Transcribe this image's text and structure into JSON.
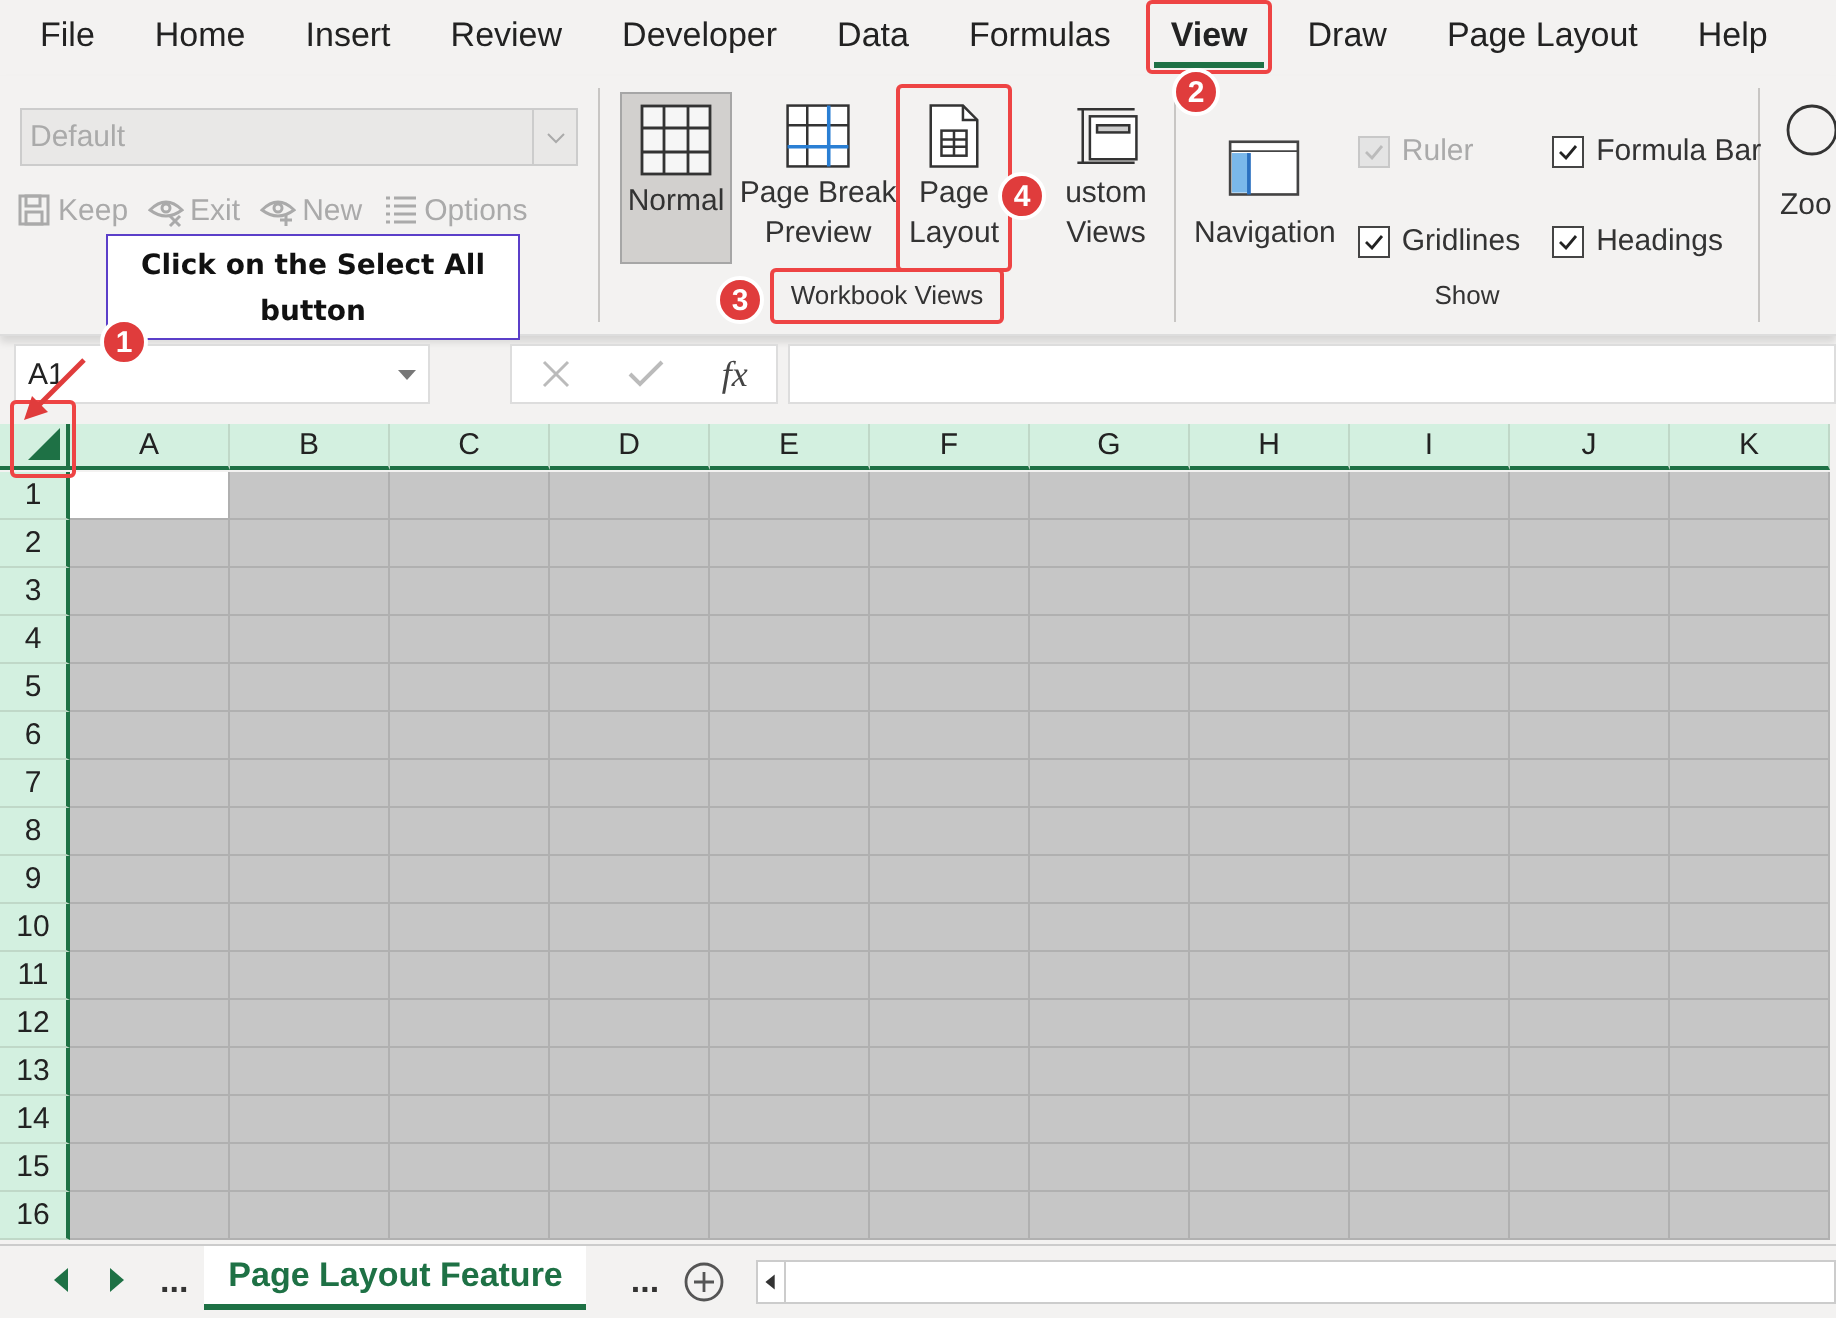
{
  "menu_tabs": [
    {
      "label": "File",
      "selected": false
    },
    {
      "label": "Home",
      "selected": false
    },
    {
      "label": "Insert",
      "selected": false
    },
    {
      "label": "Review",
      "selected": false
    },
    {
      "label": "Developer",
      "selected": false
    },
    {
      "label": "Data",
      "selected": false
    },
    {
      "label": "Formulas",
      "selected": false
    },
    {
      "label": "View",
      "selected": true
    },
    {
      "label": "Draw",
      "selected": false
    },
    {
      "label": "Page Layout",
      "selected": false
    },
    {
      "label": "Help",
      "selected": false
    }
  ],
  "sheet_view": {
    "dropdown": {
      "value": "Default",
      "disabled": true
    },
    "buttons": [
      {
        "label": "Keep",
        "disabled": true
      },
      {
        "label": "Exit",
        "disabled": true
      },
      {
        "label": "New",
        "disabled": true
      },
      {
        "label": "Options",
        "disabled": true
      }
    ]
  },
  "workbook_views": {
    "label": "Workbook Views",
    "buttons": [
      {
        "lines": [
          "Normal"
        ],
        "selected": true
      },
      {
        "lines": [
          "Page Break",
          "Preview"
        ],
        "selected": false
      },
      {
        "lines": [
          "Page",
          "Layout"
        ],
        "selected": false
      },
      {
        "lines": [
          "ustom",
          "Views"
        ],
        "selected": false
      }
    ]
  },
  "show": {
    "label": "Show",
    "navigation": "Navigation",
    "checkboxes": [
      {
        "label": "Ruler",
        "checked": true,
        "disabled": true
      },
      {
        "label": "Gridlines",
        "checked": true,
        "disabled": false
      },
      {
        "label": "Formula Bar",
        "checked": true,
        "disabled": false
      },
      {
        "label": "Headings",
        "checked": true,
        "disabled": false
      }
    ]
  },
  "zoom_group": {
    "label": "Zoo"
  },
  "formula_bar": {
    "name_box": "A1",
    "function_symbol": "fx"
  },
  "grid": {
    "columns": [
      "A",
      "B",
      "C",
      "D",
      "E",
      "F",
      "G",
      "H",
      "I",
      "J",
      "K"
    ],
    "rows": [
      "1",
      "2",
      "3",
      "4",
      "5",
      "6",
      "7",
      "8",
      "9",
      "10",
      "11",
      "12",
      "13",
      "14",
      "15",
      "16"
    ]
  },
  "sheet_tabs": {
    "more_left": "...",
    "tabs": [
      {
        "label": "Page Layout Feature",
        "selected": true
      }
    ],
    "more_right": "..."
  },
  "annotations": {
    "callout": "Click on the Select All button",
    "badges": [
      "1",
      "2",
      "3",
      "4"
    ]
  }
}
